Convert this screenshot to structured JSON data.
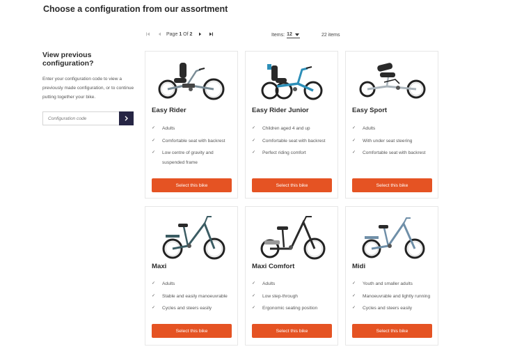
{
  "page": {
    "title": "Choose a configuration from our assortment"
  },
  "sidebar": {
    "heading": "View previous configuration?",
    "description": "Enter your configuration code to view a previously made configuration, or to continue putting together your bike.",
    "code_placeholder": "Configuration code",
    "submit_icon": "chevron-right-icon"
  },
  "pager": {
    "page_label": "Page",
    "current_page": "1",
    "of_label": "Of",
    "total_pages": "2",
    "items_label": "Items:",
    "items_per_page": "12",
    "item_count": "22 items"
  },
  "colors": {
    "accent": "#e55323",
    "dark": "#262544",
    "text": "#2b2b2b"
  },
  "products": [
    {
      "name": "Easy Rider",
      "features": [
        "Adults",
        "Comfortable seat with backrest",
        "Low centre of gravity and suspended frame"
      ],
      "button": "Select this bike",
      "image": "recumbent-trike-image"
    },
    {
      "name": "Easy Rider Junior",
      "features": [
        "Children aged 4 and up",
        "Comfortable seat with backrest",
        "Perfect riding comfort"
      ],
      "button": "Select this bike",
      "image": "recumbent-trike-junior-image"
    },
    {
      "name": "Easy Sport",
      "features": [
        "Adults",
        "With under seat steering",
        "Comfortable seat with backrest"
      ],
      "button": "Select this bike",
      "image": "sport-recumbent-trike-image"
    },
    {
      "name": "Maxi",
      "features": [
        "Adults",
        "Stable and easily manoeuvrable",
        "Cycles and steers easily"
      ],
      "button": "Select this bike",
      "image": "upright-tricycle-image"
    },
    {
      "name": "Maxi Comfort",
      "features": [
        "Adults",
        "Low step-through",
        "Ergonomic seating position"
      ],
      "button": "Select this bike",
      "image": "step-through-tricycle-image"
    },
    {
      "name": "Midi",
      "features": [
        "Youth and smaller adults",
        "Manoeuvrable and lightly running",
        "Cycles and steers easily"
      ],
      "button": "Select this bike",
      "image": "midi-tricycle-image"
    }
  ]
}
